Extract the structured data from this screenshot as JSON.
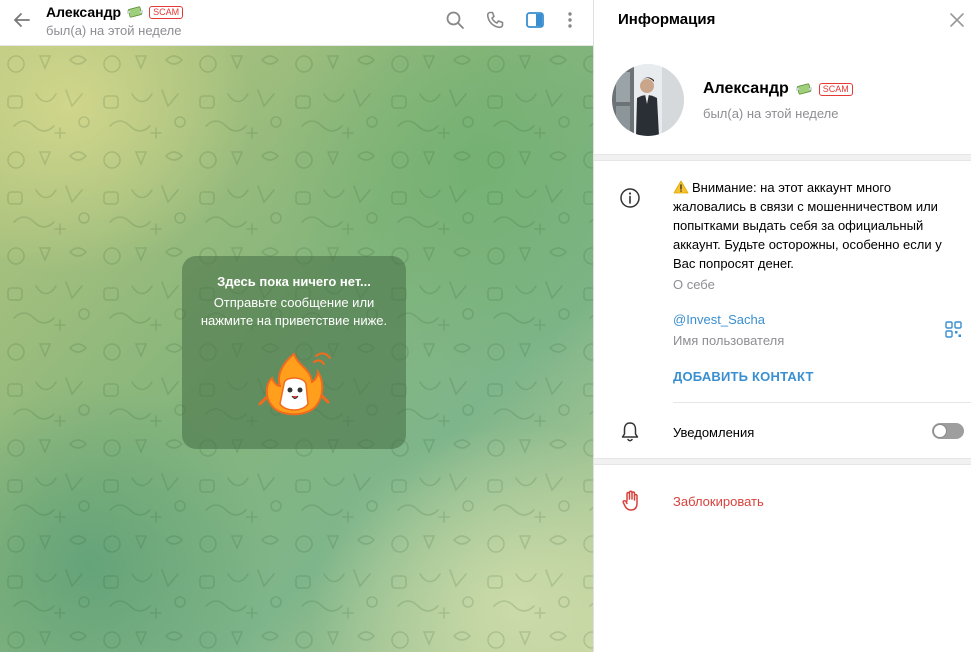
{
  "chat_header": {
    "peer_name": "Александр",
    "scam_badge": "SCAM",
    "status": "был(а) на этой неделе",
    "icons": [
      "back-arrow-icon",
      "search-icon",
      "phone-icon",
      "sidebar-toggle-icon",
      "more-vertical-icon"
    ],
    "accent_color": "#3a8fd0"
  },
  "empty_chat": {
    "title": "Здесь пока ничего нет...",
    "text": "Отправьте сообщение или нажмите на приветствие ниже."
  },
  "info_panel": {
    "title": "Информация",
    "profile": {
      "name": "Александр",
      "scam_badge": "SCAM",
      "status": "был(а) на этой неделе"
    },
    "about": {
      "warning_text": "Внимание: на этот аккаунт много жаловались в связи с мошенничеством или попытками выдать себя за официальный аккаунт. Будьте осторожны, особенно если у Вас попросят денег.",
      "label": "О себе"
    },
    "username": {
      "value": "@Invest_Sacha",
      "label": "Имя пользователя"
    },
    "add_contact": "ДОБАВИТЬ КОНТАКТ",
    "notifications": {
      "label": "Уведомления",
      "enabled": false
    },
    "block": "Заблокировать",
    "danger_color": "#d9423b"
  }
}
